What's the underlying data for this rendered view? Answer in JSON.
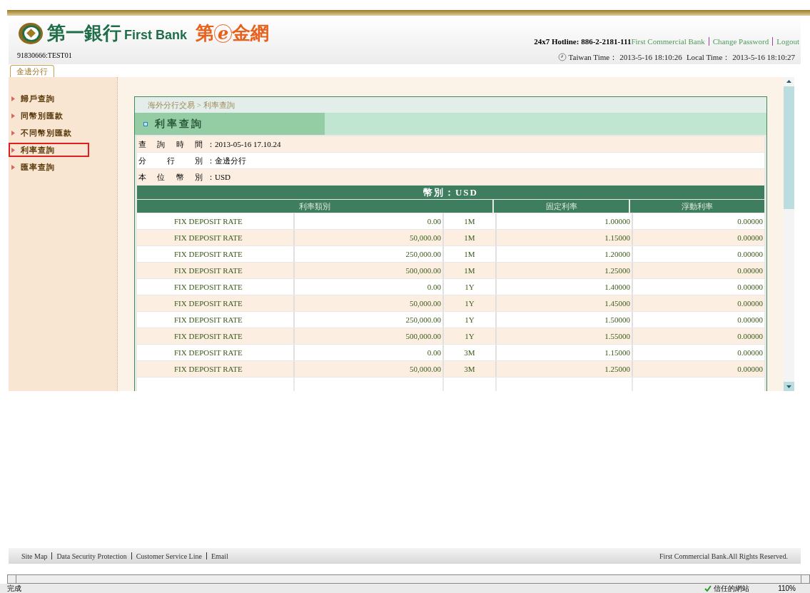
{
  "logo": {
    "bank_name": "第一銀行",
    "english_name": "First Bank",
    "service_parts": [
      "第",
      "e",
      "金網"
    ]
  },
  "user_id": "91830666:TEST01",
  "hotline": "24x7 Hotline: 886-2-2181-111",
  "top_links": [
    "First Commercial Bank",
    "Change Password",
    "Logout"
  ],
  "clock": {
    "taiwan_label": "Taiwan Time：",
    "taiwan_time": "2013-5-16 18:10:26",
    "local_label": "Local Time：",
    "local_time": "2013-5-16 18:10:27"
  },
  "tabs": [
    {
      "label": "金邊分行",
      "selected": true
    }
  ],
  "sidebar": {
    "items": [
      {
        "label": "歸戶查詢",
        "selected": false
      },
      {
        "label": "同幣別匯款",
        "selected": false
      },
      {
        "label": "不同幣別匯款",
        "selected": false
      },
      {
        "label": "利率查詢",
        "selected": true
      },
      {
        "label": "匯率查詢",
        "selected": false
      }
    ]
  },
  "breadcrumb": "海外分行交易 > 利率查詢",
  "page_title": "利率查詢",
  "info": [
    {
      "label": [
        "查",
        "詢",
        "時",
        "間"
      ],
      "value": "：2013-05-16  17.10.24"
    },
    {
      "label": [
        "分",
        "行",
        "別"
      ],
      "value": "：金邊分行"
    },
    {
      "label": [
        "本",
        "位",
        "幣",
        "別"
      ],
      "value": "：USD"
    }
  ],
  "currency_heading": "幣別：USD",
  "table": {
    "columns": [
      "利率類別",
      "固定利率",
      "浮動利率"
    ],
    "rows": [
      {
        "type": "FIX DEPOSIT RATE",
        "amount": "0.00",
        "term": "1M",
        "fixed": "1.00000",
        "floating": "0.00000"
      },
      {
        "type": "FIX DEPOSIT RATE",
        "amount": "50,000.00",
        "term": "1M",
        "fixed": "1.15000",
        "floating": "0.00000"
      },
      {
        "type": "FIX DEPOSIT RATE",
        "amount": "250,000.00",
        "term": "1M",
        "fixed": "1.20000",
        "floating": "0.00000"
      },
      {
        "type": "FIX DEPOSIT RATE",
        "amount": "500,000.00",
        "term": "1M",
        "fixed": "1.25000",
        "floating": "0.00000"
      },
      {
        "type": "FIX DEPOSIT RATE",
        "amount": "0.00",
        "term": "1Y",
        "fixed": "1.40000",
        "floating": "0.00000"
      },
      {
        "type": "FIX DEPOSIT RATE",
        "amount": "50,000.00",
        "term": "1Y",
        "fixed": "1.45000",
        "floating": "0.00000"
      },
      {
        "type": "FIX DEPOSIT RATE",
        "amount": "250,000.00",
        "term": "1Y",
        "fixed": "1.50000",
        "floating": "0.00000"
      },
      {
        "type": "FIX DEPOSIT RATE",
        "amount": "500,000.00",
        "term": "1Y",
        "fixed": "1.55000",
        "floating": "0.00000"
      },
      {
        "type": "FIX DEPOSIT RATE",
        "amount": "0.00",
        "term": "3M",
        "fixed": "1.15000",
        "floating": "0.00000"
      },
      {
        "type": "FIX DEPOSIT RATE",
        "amount": "50,000.00",
        "term": "3M",
        "fixed": "1.25000",
        "floating": "0.00000"
      }
    ]
  },
  "footer": {
    "links": [
      "Site Map",
      "Data Security Protection",
      "Customer Service Line",
      "Email"
    ],
    "copyright": "First Commercial Bank.All Rights Reserved."
  },
  "status_bar": {
    "status": "完成",
    "zone": "信任的網站",
    "zoom": "110%"
  }
}
